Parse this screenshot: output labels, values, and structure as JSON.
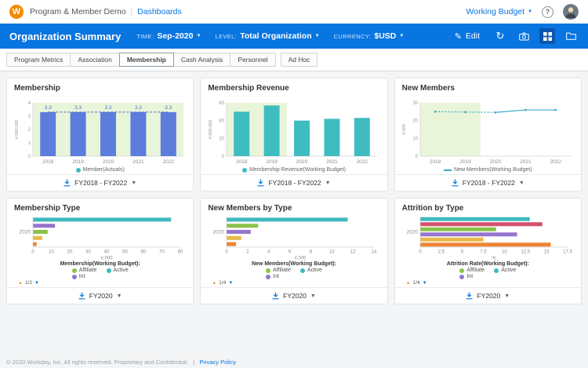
{
  "topbar": {
    "logo": "W",
    "app_title": "Program & Member Demo",
    "divider": "|",
    "nav_link": "Dashboards",
    "budget_label": "Working Budget",
    "help_icon_label": "?"
  },
  "header": {
    "title": "Organization Summary",
    "accent_color": "#0875e1",
    "filters": [
      {
        "label": "TIME:",
        "value": "Sep-2020"
      },
      {
        "label": "LEVEL:",
        "value": "Total Organization"
      },
      {
        "label": "CURRENCY:",
        "value": "$USD"
      }
    ],
    "edit_label": "Edit"
  },
  "tabs": [
    {
      "label": "Program Metrics",
      "active": false
    },
    {
      "label": "Association",
      "active": false
    },
    {
      "label": "Membership",
      "active": true
    },
    {
      "label": "Cash Analysis",
      "active": false
    },
    {
      "label": "Personnel",
      "active": false
    },
    {
      "label": "Ad Hoc",
      "active": false
    }
  ],
  "panels": [
    {
      "title": "Membership",
      "chart_data": {
        "type": "bar",
        "categories": [
          "2018",
          "2019",
          "2020",
          "2021",
          "2022"
        ],
        "values": [
          3.3,
          3.3,
          3.3,
          3.3,
          3.3
        ],
        "ylabel": "#,000,000",
        "ylim": [
          0,
          4
        ],
        "yticks": [
          0,
          1,
          2,
          3,
          4
        ],
        "bar_color": "#5c7ddb",
        "value_labels": true,
        "label_color": "#4a6fd4",
        "dash_value": 3.3,
        "shade": {
          "from": 0,
          "to": 1,
          "color": "#e9f5d9"
        }
      },
      "legend": {
        "style": "inline",
        "items": [
          {
            "label": "Member(Actuals)",
            "color": "#3fbcbf",
            "marker": "dot"
          }
        ]
      },
      "footer": {
        "range": "FY2018 - FY2022"
      }
    },
    {
      "title": "Membership Revenue",
      "chart_data": {
        "type": "bar",
        "categories": [
          "2018",
          "2019",
          "2020",
          "2021",
          "2022"
        ],
        "values": [
          50,
          57,
          40,
          42,
          43
        ],
        "ylabel": "#,000,000",
        "ylim": [
          0,
          60
        ],
        "yticks": [
          0,
          20,
          40,
          60
        ],
        "bar_color": "#3fbcbf",
        "value_labels": false,
        "shade": {
          "from": 0,
          "to": 0.4,
          "color": "#e9f5d9"
        }
      },
      "legend": {
        "style": "inline",
        "items": [
          {
            "label": "Membership Revenue(Working Budget)",
            "color": "#3fbcbf",
            "marker": "dot"
          }
        ]
      },
      "footer": {
        "range": "FY2018 - FY2022"
      }
    },
    {
      "title": "New Members",
      "chart_data": {
        "type": "line",
        "categories": [
          "2018",
          "2019",
          "2020",
          "2021",
          "2022"
        ],
        "values": [
          25,
          24.8,
          24.6,
          26,
          26
        ],
        "ylabel": "#,000",
        "ylim": [
          0,
          30
        ],
        "yticks": [
          0,
          10,
          20,
          30
        ],
        "line_color": "#3aa9c9",
        "dash_until": 2,
        "shade": {
          "from": 0,
          "to": 0.4,
          "color": "#e9f5d9"
        }
      },
      "legend": {
        "style": "inline",
        "items": [
          {
            "label": "New Members(Working Budget)",
            "color": "#3aa9c9",
            "marker": "line"
          }
        ]
      },
      "footer": {
        "range": "FY2018 - FY2022"
      }
    },
    {
      "title": "Membership Type",
      "chart_data": {
        "type": "hbar",
        "category": "2020",
        "series": [
          {
            "name": "Active",
            "value": 75,
            "color": "#3fb8bf"
          },
          {
            "name": "Int",
            "value": 12,
            "color": "#9575cd"
          },
          {
            "name": "Affiliate",
            "value": 8,
            "color": "#8bc34a"
          },
          {
            "name": "",
            "value": 5,
            "color": "#e9b949"
          },
          {
            "name": "",
            "value": 2,
            "color": "#ee8434"
          }
        ],
        "xlim": [
          0,
          80
        ],
        "xticks": [
          0,
          10,
          20,
          30,
          40,
          50,
          60,
          70,
          80
        ],
        "xlabel": "#,000"
      },
      "legend": {
        "style": "block",
        "title": "Membership(Working Budget):",
        "items": [
          {
            "label": "Affiliate",
            "color": "#8bc34a",
            "marker": "dot"
          },
          {
            "label": "Active",
            "color": "#3fb8bf",
            "marker": "dot"
          },
          {
            "label": "Int",
            "color": "#9575cd",
            "marker": "dot"
          }
        ],
        "pagination": "1/2"
      },
      "footer": {
        "range": "FY2020"
      }
    },
    {
      "title": "New Members by Type",
      "chart_data": {
        "type": "hbar",
        "category": "2020",
        "series": [
          {
            "name": "Active",
            "value": 11.5,
            "color": "#3fb8bf"
          },
          {
            "name": "Affiliate",
            "value": 3,
            "color": "#8bc34a"
          },
          {
            "name": "Int",
            "value": 2.3,
            "color": "#9575cd"
          },
          {
            "name": "",
            "value": 1.4,
            "color": "#e9b949"
          },
          {
            "name": "",
            "value": 0.9,
            "color": "#ee8434"
          }
        ],
        "xlim": [
          0,
          14
        ],
        "xticks": [
          0,
          2,
          4,
          6,
          8,
          10,
          12,
          14
        ],
        "xlabel": "#,000"
      },
      "legend": {
        "style": "block",
        "title": "New Members(Working Budget):",
        "items": [
          {
            "label": "Affiliate",
            "color": "#8bc34a",
            "marker": "dot"
          },
          {
            "label": "Active",
            "color": "#3fb8bf",
            "marker": "dot"
          },
          {
            "label": "Int",
            "color": "#9575cd",
            "marker": "dot"
          }
        ],
        "pagination": "1/4"
      },
      "footer": {
        "range": "FY2020"
      }
    },
    {
      "title": "Attrition by Type",
      "chart_data": {
        "type": "hbar",
        "category": "2020",
        "series": [
          {
            "name": "Active",
            "value": 13,
            "color": "#3fb8bf"
          },
          {
            "name": "",
            "value": 14.5,
            "color": "#d4526e"
          },
          {
            "name": "Affiliate",
            "value": 9,
            "color": "#8bc34a"
          },
          {
            "name": "Int",
            "value": 11.5,
            "color": "#9575cd"
          },
          {
            "name": "",
            "value": 7.5,
            "color": "#e9b949"
          },
          {
            "name": "",
            "value": 15.5,
            "color": "#ee8434"
          }
        ],
        "xlim": [
          0,
          17.5
        ],
        "xticks": [
          0,
          2.5,
          5,
          7.5,
          10,
          12.5,
          15,
          17.5
        ],
        "xlabel": "%"
      },
      "legend": {
        "style": "block",
        "title": "Attrition Rate(Working Budget):",
        "items": [
          {
            "label": "Affiliate",
            "color": "#8bc34a",
            "marker": "dot"
          },
          {
            "label": "Active",
            "color": "#3fb8bf",
            "marker": "dot"
          },
          {
            "label": "Int",
            "color": "#9575cd",
            "marker": "dot"
          }
        ],
        "pagination": "1/4"
      },
      "footer": {
        "range": "FY2020"
      }
    }
  ],
  "page_footer": {
    "copyright": "© 2020 Workday, Inc. All rights reserved. Proprietary and Confidential.",
    "divider": "|",
    "privacy_link": "Privacy Policy"
  }
}
